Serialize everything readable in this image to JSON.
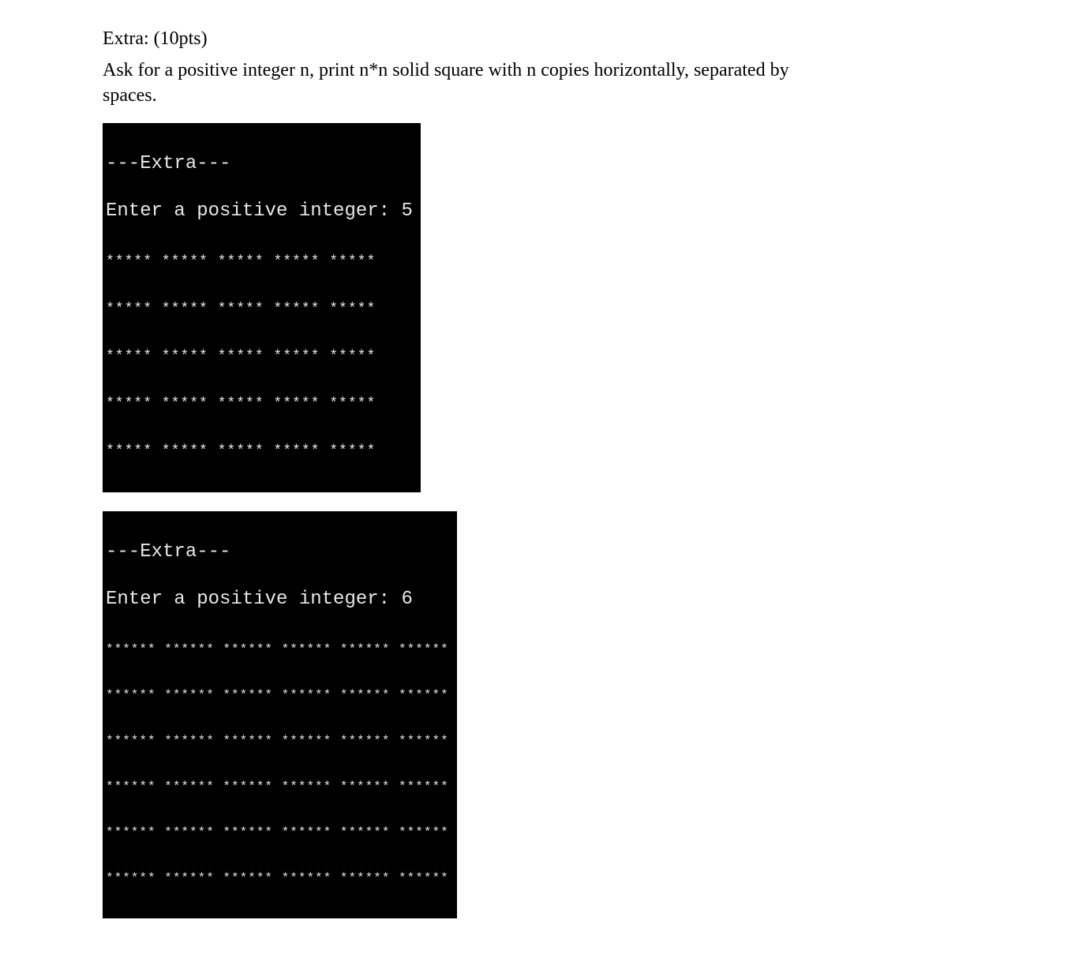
{
  "heading": "Extra: (10pts)",
  "description": "Ask for a positive integer n, print n*n solid square with n copies horizontally, separated by spaces.",
  "terminal1": {
    "header": "---Extra---",
    "prompt": "Enter a positive integer: 5",
    "rows": [
      "***** ***** ***** ***** *****",
      "***** ***** ***** ***** *****",
      "***** ***** ***** ***** *****",
      "***** ***** ***** ***** *****",
      "***** ***** ***** ***** *****"
    ]
  },
  "terminal2": {
    "header": "---Extra---",
    "prompt": "Enter a positive integer: 6",
    "rows": [
      "****** ****** ****** ****** ****** ******",
      "****** ****** ****** ****** ****** ******",
      "****** ****** ****** ****** ****** ******",
      "****** ****** ****** ****** ****** ******",
      "****** ****** ****** ****** ****** ******",
      "****** ****** ****** ****** ****** ******"
    ]
  }
}
